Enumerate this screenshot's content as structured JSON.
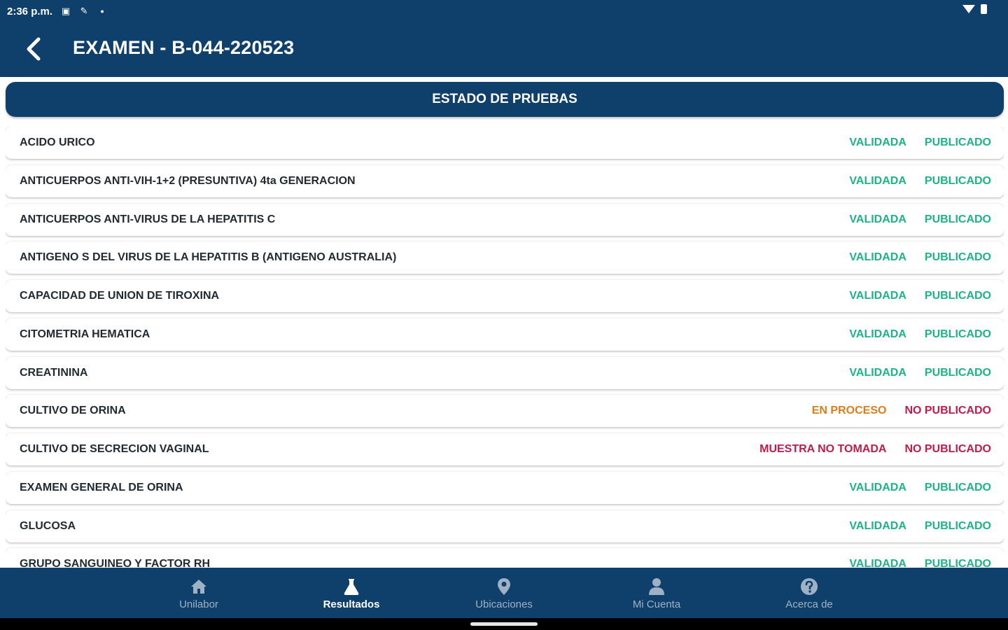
{
  "status_bar": {
    "time": "2:36 p.m.",
    "icons": [
      "sim-icon",
      "pen-icon",
      "dot-icon",
      "wifi-icon",
      "battery-icon"
    ]
  },
  "header": {
    "title": "EXAMEN - B-044-220523",
    "back_icon": "chevron-left-icon"
  },
  "section": {
    "title": "ESTADO DE PRUEBAS"
  },
  "colors": {
    "primary": "#0f3f6b",
    "validated": "#1db388",
    "in_process": "#e07b1a",
    "not_published": "#c21a4a"
  },
  "tests": [
    {
      "name": "ACIDO URICO",
      "status": "VALIDADA",
      "publication": "PUBLICADO"
    },
    {
      "name": "ANTICUERPOS ANTI-VIH-1+2 (PRESUNTIVA) 4ta GENERACION",
      "status": "VALIDADA",
      "publication": "PUBLICADO"
    },
    {
      "name": "ANTICUERPOS ANTI-VIRUS DE LA HEPATITIS C",
      "status": "VALIDADA",
      "publication": "PUBLICADO"
    },
    {
      "name": "ANTIGENO S DEL VIRUS DE LA HEPATITIS B (ANTIGENO AUSTRALIA)",
      "status": "VALIDADA",
      "publication": "PUBLICADO"
    },
    {
      "name": "CAPACIDAD DE UNION DE TIROXINA",
      "status": "VALIDADA",
      "publication": "PUBLICADO"
    },
    {
      "name": "CITOMETRIA HEMATICA",
      "status": "VALIDADA",
      "publication": "PUBLICADO"
    },
    {
      "name": "CREATININA",
      "status": "VALIDADA",
      "publication": "PUBLICADO"
    },
    {
      "name": "CULTIVO DE ORINA",
      "status": "EN PROCESO",
      "publication": "NO PUBLICADO"
    },
    {
      "name": "CULTIVO DE SECRECION VAGINAL",
      "status": "MUESTRA NO TOMADA",
      "publication": "NO PUBLICADO"
    },
    {
      "name": "EXAMEN GENERAL DE ORINA",
      "status": "VALIDADA",
      "publication": "PUBLICADO"
    },
    {
      "name": "GLUCOSA",
      "status": "VALIDADA",
      "publication": "PUBLICADO"
    },
    {
      "name": "GRUPO SANGUINEO Y FACTOR RH",
      "status": "VALIDADA",
      "publication": "PUBLICADO"
    }
  ],
  "bottom_nav": [
    {
      "label": "Unilabor",
      "icon": "home-icon"
    },
    {
      "label": "Resultados",
      "icon": "flask-icon",
      "active": true
    },
    {
      "label": "Ubicaciones",
      "icon": "location-pin-icon"
    },
    {
      "label": "Mi Cuenta",
      "icon": "user-icon"
    },
    {
      "label": "Acerca de",
      "icon": "help-icon"
    }
  ]
}
